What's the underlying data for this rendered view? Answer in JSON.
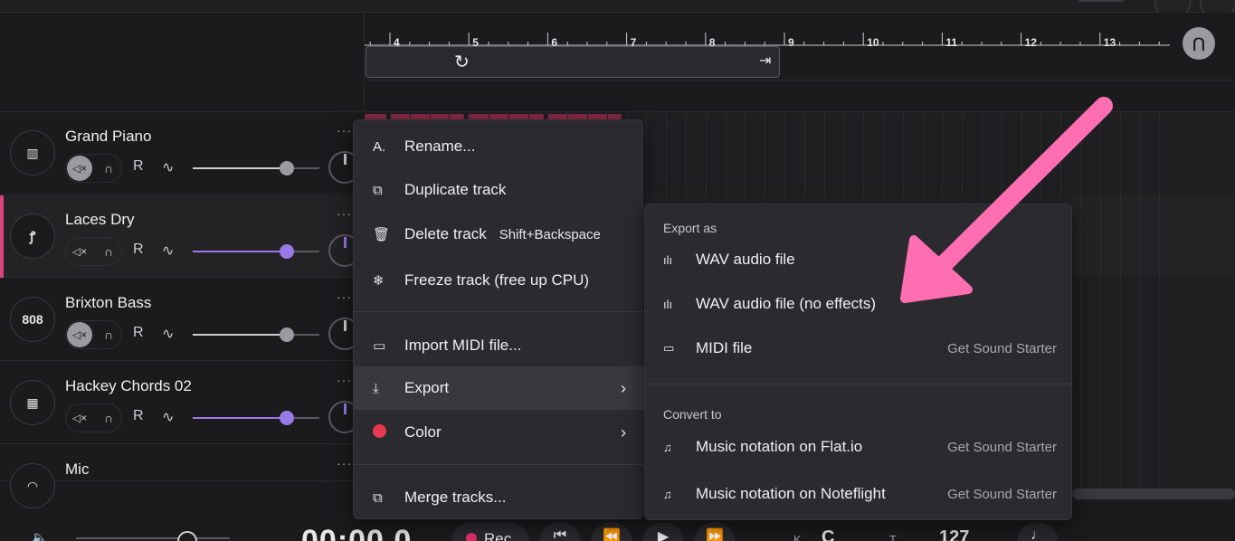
{
  "ruler": {
    "bars": [
      "4",
      "5",
      "6",
      "7",
      "8",
      "9",
      "10",
      "11",
      "12",
      "13"
    ]
  },
  "tracks": [
    {
      "name": "Grand Piano",
      "icon": "piano-icon",
      "icon_glyph": "▥",
      "muted": true,
      "volume": 0.74,
      "volume_color": "#cfcfd2"
    },
    {
      "name": "Laces Dry",
      "icon": "drum-icon",
      "icon_glyph": "ꝭ",
      "muted": false,
      "volume": 0.74,
      "volume_color": "#9a7ae8",
      "selected": true
    },
    {
      "name": "Brixton Bass",
      "icon": "808-icon",
      "icon_glyph": "808",
      "muted": true,
      "volume": 0.74,
      "volume_color": "#cfcfd2"
    },
    {
      "name": "Hackey Chords 02",
      "icon": "keyboard-icon",
      "icon_glyph": "▦",
      "muted": false,
      "volume": 0.74,
      "volume_color": "#9a7ae8"
    },
    {
      "name": "Mic",
      "icon": "mic-icon",
      "icon_glyph": "◠"
    }
  ],
  "track_controls": {
    "more": "···",
    "record_label": "R"
  },
  "menu": {
    "items": [
      {
        "label": "Rename...",
        "icon": "rename-icon",
        "glyph": "A."
      },
      {
        "label": "Duplicate track",
        "icon": "duplicate-icon",
        "glyph": "⧉"
      },
      {
        "label": "Delete track",
        "icon": "trash-icon",
        "glyph": "🗑",
        "shortcut": "Shift+Backspace"
      },
      {
        "label": "Freeze track (free up CPU)",
        "icon": "snowflake-icon",
        "glyph": "❄"
      },
      {
        "label": "Import MIDI file...",
        "icon": "midi-icon",
        "glyph": "▭"
      },
      {
        "label": "Export",
        "icon": "download-icon",
        "glyph": "⤓"
      },
      {
        "label": "Color",
        "icon": "color-dot-icon"
      },
      {
        "label": "Merge tracks...",
        "icon": "merge-icon",
        "glyph": "⧉"
      }
    ]
  },
  "submenu": {
    "export_header": "Export as",
    "export_items": [
      {
        "label": "WAV audio file",
        "icon": "waveform-icon",
        "glyph": "ılı"
      },
      {
        "label": "WAV audio file (no effects)",
        "icon": "waveform-icon",
        "glyph": "ılı"
      },
      {
        "label": "MIDI file",
        "icon": "midi-icon",
        "glyph": "▭",
        "badge": "Get Sound Starter"
      }
    ],
    "convert_header": "Convert to",
    "convert_items": [
      {
        "label": "Music notation on Flat.io",
        "icon": "music-note-icon",
        "glyph": "♫",
        "badge": "Get Sound Starter"
      },
      {
        "label": "Music notation on Noteflight",
        "icon": "music-note-icon",
        "glyph": "♫",
        "badge": "Get Sound Starter"
      }
    ]
  },
  "transport": {
    "time": "00:00.0",
    "rec_label": "Rec",
    "key_label": "K",
    "key_value": "C",
    "tempo_label": "T",
    "tempo_value": "127"
  },
  "colors": {
    "accent_pink": "#d9467e",
    "annotation_arrow": "#ff6eb0",
    "purple": "#9a7ae8",
    "menu_bg": "#2b2b2f"
  }
}
